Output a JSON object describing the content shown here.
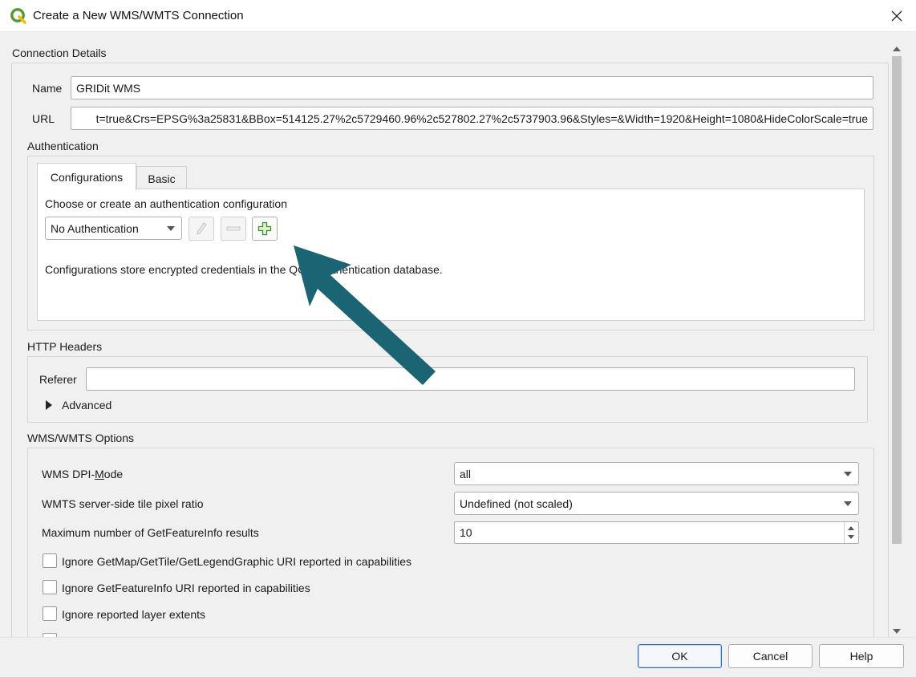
{
  "window": {
    "title": "Create a New WMS/WMTS Connection",
    "app_icon": "qgis-logo-icon",
    "close_icon": "close-icon"
  },
  "connection_details": {
    "group_title": "Connection Details",
    "name_label": "Name",
    "name_value": "GRIDit WMS",
    "url_label": "URL",
    "url_value": "t=true&Crs=EPSG%3a25831&BBox=514125.27%2c5729460.96%2c527802.27%2c5737903.96&Styles=&Width=1920&Height=1080&HideColorScale=true"
  },
  "authentication": {
    "group_title": "Authentication",
    "tabs": [
      {
        "label": "Configurations",
        "active": true
      },
      {
        "label": "Basic",
        "active": false
      }
    ],
    "prompt": "Choose or create an authentication configuration",
    "config_select": "No Authentication",
    "edit_icon": "pencil-icon",
    "remove_icon": "minus-icon",
    "add_icon": "plus-icon",
    "info_text": "Configurations store encrypted credentials in the QGIS authentication database."
  },
  "http_headers": {
    "group_title": "HTTP Headers",
    "referer_label": "Referer",
    "referer_value": "",
    "advanced_label": "Advanced",
    "expand_icon": "triangle-right-icon"
  },
  "wms_options": {
    "group_title": "WMS/WMTS Options",
    "dpi_mode_label_pre": "WMS DPI-",
    "dpi_mode_label_ul": "M",
    "dpi_mode_label_post": "ode",
    "dpi_mode_value": "all",
    "tile_ratio_label": "WMTS server-side tile pixel ratio",
    "tile_ratio_value": "Undefined (not scaled)",
    "max_results_label": "Maximum number of GetFeatureInfo results",
    "max_results_value": "10",
    "checkboxes": [
      {
        "label": "Ignore GetMap/GetTile/GetLegendGraphic URI reported in capabilities",
        "checked": false
      },
      {
        "label": "Ignore GetFeatureInfo URI reported in capabilities",
        "checked": false
      },
      {
        "label": "Ignore reported layer extents",
        "checked": false
      }
    ]
  },
  "buttons": {
    "ok": "OK",
    "cancel": "Cancel",
    "help": "Help"
  },
  "colors": {
    "annotation_arrow": "#1a6473",
    "qgis_green": "#589632",
    "qgis_yellow": "#eebe0f",
    "default_button_border": "#2f6fc4"
  }
}
